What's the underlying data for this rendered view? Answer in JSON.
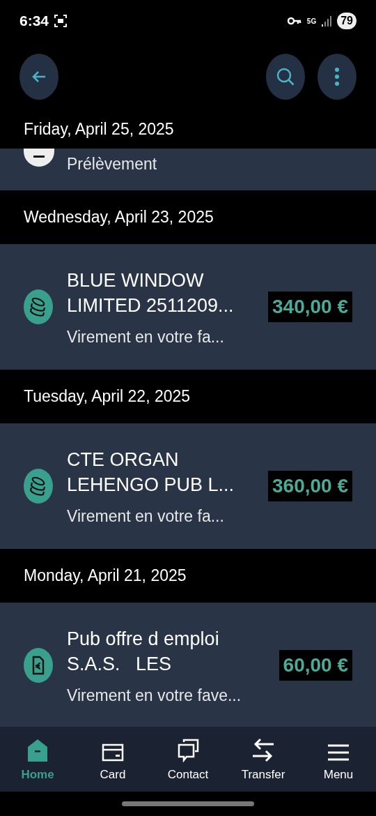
{
  "status_bar": {
    "time": "6:34",
    "network": "5G",
    "battery": "79"
  },
  "top_bar": {
    "buttons": [
      {
        "kind": "back"
      },
      {
        "kind": "search"
      },
      {
        "kind": "more"
      }
    ]
  },
  "first_date": "Friday, April 25, 2025",
  "partial_transaction": {
    "subtitle": "Prélèvement"
  },
  "days": [
    {
      "date": "Wednesday, April 23, 2025",
      "transactions": [
        {
          "kind": "coins",
          "title_lines": [
            "BLUE WINDOW",
            "LIMITED 2511209..."
          ],
          "subtitle": "Virement en votre fa...",
          "amount": "340,00 €"
        }
      ]
    },
    {
      "date": "Tuesday, April 22, 2025",
      "transactions": [
        {
          "kind": "coins",
          "title_lines": [
            "CTE ORGAN",
            "LEHENGO PUB L..."
          ],
          "subtitle": "Virement en votre fa...",
          "amount": "360,00 €"
        }
      ]
    },
    {
      "date": "Monday, April 21, 2025",
      "transactions": [
        {
          "kind": "document",
          "title_lines": [
            "Pub offre d emploi",
            "S.A.S.   LES"
          ],
          "subtitle": "Virement en votre fave...",
          "amount": "60,00 €"
        }
      ]
    }
  ],
  "bottom_nav": [
    {
      "kind": "home",
      "label": "Home",
      "selected": true
    },
    {
      "kind": "card",
      "label": "Card",
      "selected": false
    },
    {
      "kind": "contact",
      "label": "Contact",
      "selected": false
    },
    {
      "kind": "transfer",
      "label": "Transfer",
      "selected": false
    },
    {
      "kind": "menu",
      "label": "Menu",
      "selected": false
    }
  ]
}
